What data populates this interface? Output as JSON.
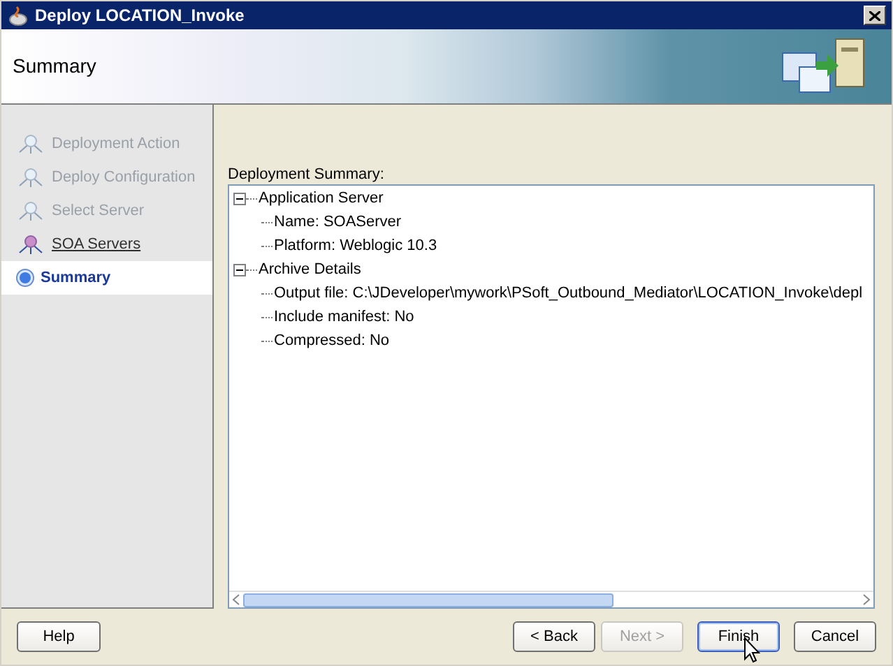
{
  "window": {
    "title": "Deploy LOCATION_Invoke"
  },
  "header": {
    "title": "Summary"
  },
  "steps": [
    {
      "label": "Deployment Action",
      "selected": false,
      "disabled": true
    },
    {
      "label": "Deploy Configuration",
      "selected": false,
      "disabled": true
    },
    {
      "label": "Select Server",
      "selected": false,
      "disabled": true
    },
    {
      "label": "SOA Servers",
      "selected": false,
      "disabled": false
    },
    {
      "label": "Summary",
      "selected": true,
      "disabled": false
    }
  ],
  "summary": {
    "label": "Deployment Summary:",
    "tree": [
      {
        "label": "Application Server",
        "expanded": true,
        "children": [
          {
            "label": "Name: SOAServer"
          },
          {
            "label": "Platform: Weblogic 10.3"
          }
        ]
      },
      {
        "label": "Archive Details",
        "expanded": true,
        "children": [
          {
            "label": "Output file: C:\\JDeveloper\\mywork\\PSoft_Outbound_Mediator\\LOCATION_Invoke\\depl"
          },
          {
            "label": "Include manifest: No"
          },
          {
            "label": "Compressed: No"
          }
        ]
      }
    ]
  },
  "buttons": [
    {
      "label": "Help",
      "disabled": false,
      "default": false
    },
    {
      "label": "< Back",
      "disabled": false,
      "default": false
    },
    {
      "label": "Next >",
      "disabled": true,
      "default": false
    },
    {
      "label": "Finish",
      "disabled": false,
      "default": true
    },
    {
      "label": "Cancel",
      "disabled": false,
      "default": false
    }
  ]
}
